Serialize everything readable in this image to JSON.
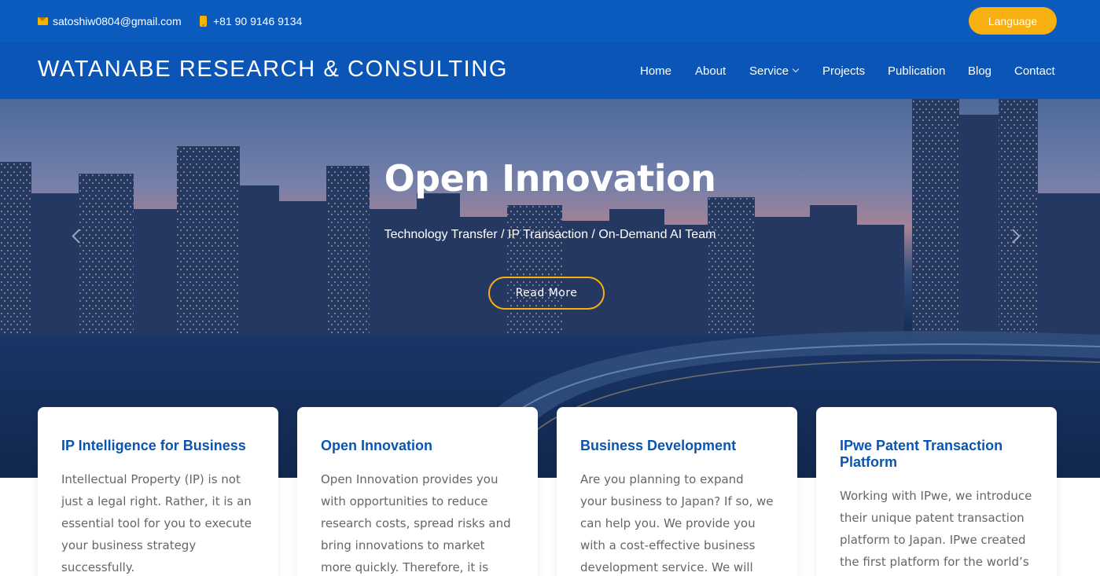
{
  "topbar": {
    "email": "satoshiw0804@gmail.com",
    "phone": "+81 90 9146 9134",
    "language_label": "Language"
  },
  "header": {
    "site_title": "WATANABE RESEARCH & CONSULTING",
    "nav": [
      {
        "label": "Home"
      },
      {
        "label": "About"
      },
      {
        "label": "Service",
        "has_dropdown": true
      },
      {
        "label": "Projects"
      },
      {
        "label": "Publication"
      },
      {
        "label": "Blog"
      },
      {
        "label": "Contact"
      }
    ]
  },
  "hero": {
    "title": "Open Innovation",
    "subtitle": "Technology Transfer / IP Transaction / On-Demand AI Team",
    "cta_label": "Read More"
  },
  "cards": [
    {
      "title": "IP Intelligence for Business",
      "text": "Intellectual Property (IP) is not just a legal right. Rather, it is an essential tool for you to execute your business strategy successfully."
    },
    {
      "title": "Open Innovation",
      "text": "Open Innovation provides you with opportunities to reduce research costs, spread risks and bring innovations to market more quickly. Therefore, it is now one of"
    },
    {
      "title": "Business Development",
      "text": "Are you planning to expand your business to Japan? If so, we can help you. We provide you with a cost-effective business development service. We will act"
    },
    {
      "title": "IPwe Patent Transaction Platform",
      "text": "Working with IPwe, we introduce their unique patent transaction platform to Japan. IPwe created the first platform for the world’s"
    }
  ],
  "colors": {
    "topbar_bg": "#0b5bbf",
    "header_bg": "#0a55b6",
    "accent": "#f8b010",
    "card_title": "#0b55b0"
  },
  "icons": {
    "email": "mail-icon",
    "phone": "phone-icon",
    "dropdown": "chevron-down-icon",
    "prev": "chevron-left-icon",
    "next": "chevron-right-icon"
  }
}
